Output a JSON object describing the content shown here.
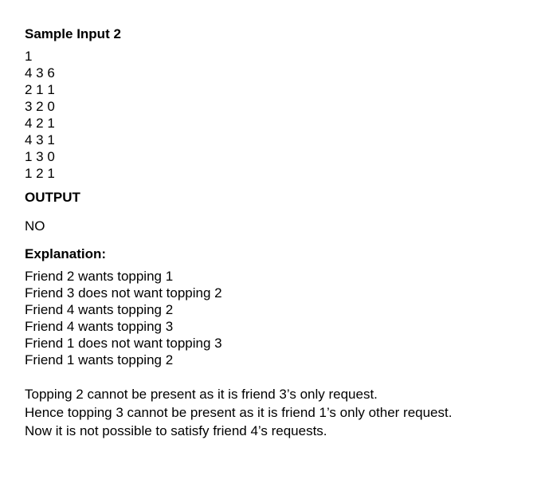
{
  "sample_input": {
    "heading": "Sample Input 2",
    "lines": [
      "1",
      "4 3 6",
      "2 1 1",
      "3 2 0",
      "4 2 1",
      "4 3 1",
      "1 3 0",
      "1 2 1"
    ]
  },
  "output": {
    "heading": "OUTPUT",
    "value": "NO"
  },
  "explanation": {
    "heading": "Explanation:",
    "requests": [
      "Friend 2 wants topping 1",
      "Friend 3 does not want topping 2",
      "Friend 4 wants topping 2",
      "Friend 4 wants topping 3",
      "Friend 1 does not want topping 3",
      "Friend 1 wants topping 2"
    ],
    "reasoning": [
      "Topping 2 cannot be present as it is friend 3’s only request.",
      "Hence topping 3 cannot be present as it is friend 1’s only other request.",
      "Now it is not possible to satisfy friend 4’s requests."
    ]
  }
}
